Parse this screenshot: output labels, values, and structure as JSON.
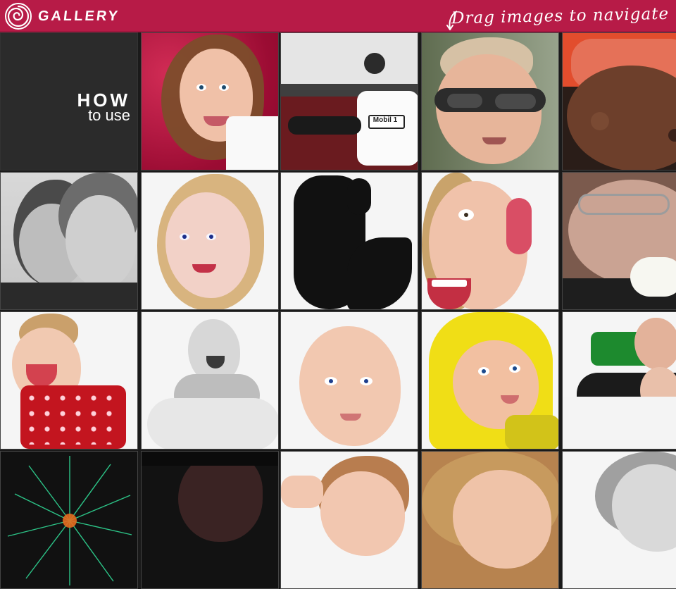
{
  "header": {
    "brand": "GALLERY",
    "hint": "Drag images to navigate"
  },
  "howto": {
    "line1": "HOW",
    "line2": "to use"
  },
  "colors": {
    "header_bg": "#b71b47",
    "howto_bg": "#2b2b2b"
  },
  "icons": {
    "logo": "spiral-logo-icon",
    "hint_arrow": "curved-arrow-icon"
  },
  "tiles": [
    "portrait-brown-hair-red-background",
    "racing-crew-mobil-1",
    "man-aviator-sunglasses",
    "driver-red-cap",
    "father-daughter-monochrome",
    "blonde-woman-portrait",
    "silhouette-profile",
    "woman-with-headphones-shouting",
    "man-with-rose",
    "laughing-baby-red",
    "baby-monochrome",
    "baby-portrait",
    "child-yellow-hood",
    "couple-lying-down",
    "fireworks",
    "dark-hair-portrait",
    "child-partial-portrait",
    "blonde-partial-portrait",
    "child-partial-monochrome"
  ]
}
